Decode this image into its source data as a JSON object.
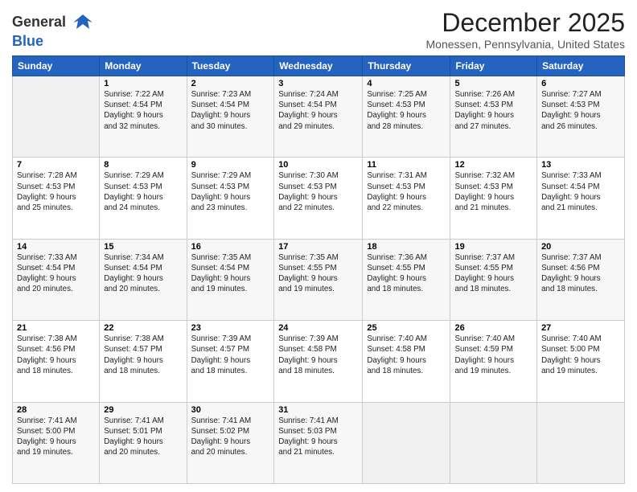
{
  "header": {
    "logo_line1": "General",
    "logo_line2": "Blue",
    "month": "December 2025",
    "location": "Monessen, Pennsylvania, United States"
  },
  "weekdays": [
    "Sunday",
    "Monday",
    "Tuesday",
    "Wednesday",
    "Thursday",
    "Friday",
    "Saturday"
  ],
  "weeks": [
    [
      {
        "day": "",
        "info": ""
      },
      {
        "day": "1",
        "info": "Sunrise: 7:22 AM\nSunset: 4:54 PM\nDaylight: 9 hours\nand 32 minutes."
      },
      {
        "day": "2",
        "info": "Sunrise: 7:23 AM\nSunset: 4:54 PM\nDaylight: 9 hours\nand 30 minutes."
      },
      {
        "day": "3",
        "info": "Sunrise: 7:24 AM\nSunset: 4:54 PM\nDaylight: 9 hours\nand 29 minutes."
      },
      {
        "day": "4",
        "info": "Sunrise: 7:25 AM\nSunset: 4:53 PM\nDaylight: 9 hours\nand 28 minutes."
      },
      {
        "day": "5",
        "info": "Sunrise: 7:26 AM\nSunset: 4:53 PM\nDaylight: 9 hours\nand 27 minutes."
      },
      {
        "day": "6",
        "info": "Sunrise: 7:27 AM\nSunset: 4:53 PM\nDaylight: 9 hours\nand 26 minutes."
      }
    ],
    [
      {
        "day": "7",
        "info": "Sunrise: 7:28 AM\nSunset: 4:53 PM\nDaylight: 9 hours\nand 25 minutes."
      },
      {
        "day": "8",
        "info": "Sunrise: 7:29 AM\nSunset: 4:53 PM\nDaylight: 9 hours\nand 24 minutes."
      },
      {
        "day": "9",
        "info": "Sunrise: 7:29 AM\nSunset: 4:53 PM\nDaylight: 9 hours\nand 23 minutes."
      },
      {
        "day": "10",
        "info": "Sunrise: 7:30 AM\nSunset: 4:53 PM\nDaylight: 9 hours\nand 22 minutes."
      },
      {
        "day": "11",
        "info": "Sunrise: 7:31 AM\nSunset: 4:53 PM\nDaylight: 9 hours\nand 22 minutes."
      },
      {
        "day": "12",
        "info": "Sunrise: 7:32 AM\nSunset: 4:53 PM\nDaylight: 9 hours\nand 21 minutes."
      },
      {
        "day": "13",
        "info": "Sunrise: 7:33 AM\nSunset: 4:54 PM\nDaylight: 9 hours\nand 21 minutes."
      }
    ],
    [
      {
        "day": "14",
        "info": "Sunrise: 7:33 AM\nSunset: 4:54 PM\nDaylight: 9 hours\nand 20 minutes."
      },
      {
        "day": "15",
        "info": "Sunrise: 7:34 AM\nSunset: 4:54 PM\nDaylight: 9 hours\nand 20 minutes."
      },
      {
        "day": "16",
        "info": "Sunrise: 7:35 AM\nSunset: 4:54 PM\nDaylight: 9 hours\nand 19 minutes."
      },
      {
        "day": "17",
        "info": "Sunrise: 7:35 AM\nSunset: 4:55 PM\nDaylight: 9 hours\nand 19 minutes."
      },
      {
        "day": "18",
        "info": "Sunrise: 7:36 AM\nSunset: 4:55 PM\nDaylight: 9 hours\nand 18 minutes."
      },
      {
        "day": "19",
        "info": "Sunrise: 7:37 AM\nSunset: 4:55 PM\nDaylight: 9 hours\nand 18 minutes."
      },
      {
        "day": "20",
        "info": "Sunrise: 7:37 AM\nSunset: 4:56 PM\nDaylight: 9 hours\nand 18 minutes."
      }
    ],
    [
      {
        "day": "21",
        "info": "Sunrise: 7:38 AM\nSunset: 4:56 PM\nDaylight: 9 hours\nand 18 minutes."
      },
      {
        "day": "22",
        "info": "Sunrise: 7:38 AM\nSunset: 4:57 PM\nDaylight: 9 hours\nand 18 minutes."
      },
      {
        "day": "23",
        "info": "Sunrise: 7:39 AM\nSunset: 4:57 PM\nDaylight: 9 hours\nand 18 minutes."
      },
      {
        "day": "24",
        "info": "Sunrise: 7:39 AM\nSunset: 4:58 PM\nDaylight: 9 hours\nand 18 minutes."
      },
      {
        "day": "25",
        "info": "Sunrise: 7:40 AM\nSunset: 4:58 PM\nDaylight: 9 hours\nand 18 minutes."
      },
      {
        "day": "26",
        "info": "Sunrise: 7:40 AM\nSunset: 4:59 PM\nDaylight: 9 hours\nand 19 minutes."
      },
      {
        "day": "27",
        "info": "Sunrise: 7:40 AM\nSunset: 5:00 PM\nDaylight: 9 hours\nand 19 minutes."
      }
    ],
    [
      {
        "day": "28",
        "info": "Sunrise: 7:41 AM\nSunset: 5:00 PM\nDaylight: 9 hours\nand 19 minutes."
      },
      {
        "day": "29",
        "info": "Sunrise: 7:41 AM\nSunset: 5:01 PM\nDaylight: 9 hours\nand 20 minutes."
      },
      {
        "day": "30",
        "info": "Sunrise: 7:41 AM\nSunset: 5:02 PM\nDaylight: 9 hours\nand 20 minutes."
      },
      {
        "day": "31",
        "info": "Sunrise: 7:41 AM\nSunset: 5:03 PM\nDaylight: 9 hours\nand 21 minutes."
      },
      {
        "day": "",
        "info": ""
      },
      {
        "day": "",
        "info": ""
      },
      {
        "day": "",
        "info": ""
      }
    ]
  ]
}
